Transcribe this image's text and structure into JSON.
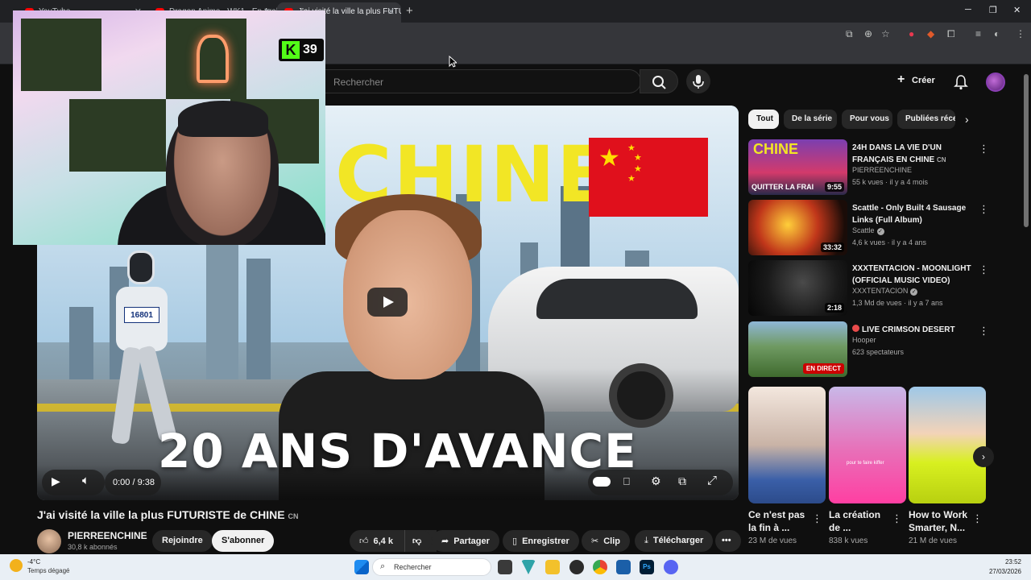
{
  "browser": {
    "tabs": [
      {
        "title": "YouTube"
      },
      {
        "title": "Dragon Anime - WK1 - En Arabe"
      },
      {
        "title": "J'ai visité la ville la plus FUTURISTE de CHINE"
      }
    ]
  },
  "header": {
    "search_placeholder": "Rechercher",
    "create_label": "Créer"
  },
  "player": {
    "thumb_title": "CHINE",
    "thumb_caption": "20 ANS D'AVANCE",
    "robot_bib": "16801",
    "time": "0:00 / 9:38"
  },
  "overlay": {
    "kick_count": "39"
  },
  "video": {
    "title": "J'ai visité la ville la plus FUTURISTE de CHINE",
    "title_suffix": "CN",
    "channel_name": "PIERREENCHINE",
    "subscribers": "30,8 k abonnés",
    "join_label": "Rejoindre",
    "subscribe_label": "S'abonner",
    "likes": "6,4 k",
    "share_label": "Partager",
    "save_label": "Enregistrer",
    "clip_label": "Clip",
    "download_label": "Télécharger"
  },
  "chips": [
    {
      "label": "Tout"
    },
    {
      "label": "De la série"
    },
    {
      "label": "Pour vous"
    },
    {
      "label": "Publiées récemment"
    }
  ],
  "recommendations": [
    {
      "title": "24H DANS LA VIE D'UN FRANÇAIS EN CHINE",
      "title_suffix": "CN",
      "channel": "PIERREENCHINE",
      "stats": "55 k vues · il y a 4 mois",
      "duration": "9:55",
      "thumb_text": "CHINE",
      "thumb_sub": "QUITTER LA FRAI"
    },
    {
      "title": "Scattle - Only Built 4 Sausage Links (Full Album)",
      "channel": "Scattle",
      "stats": "4,6 k vues · il y a 4 ans",
      "duration": "33:32"
    },
    {
      "title": "XXXTENTACION - MOONLIGHT (OFFICIAL MUSIC VIDEO)",
      "channel": "XXXTENTACION",
      "stats": "1,3 Md de vues · il y a 7 ans",
      "duration": "2:18"
    },
    {
      "title": "LIVE CRIMSON DESERT",
      "channel": "Hooper",
      "stats": "623 spectateurs",
      "live_badge": "EN DIRECT"
    }
  ],
  "shorts": [
    {
      "title": "Ce n'est pas la fin à ...",
      "views": "23 M de vues"
    },
    {
      "title": "La création de ...",
      "views": "838 k vues",
      "thumb_text": "pour te faire kiffer"
    },
    {
      "title": "How to Work Smarter, N...",
      "views": "21 M de vues"
    }
  ],
  "taskbar": {
    "temp": "-4°C",
    "weather": "Temps dégagé",
    "search_label": "Rechercher",
    "time": "23:52",
    "date": "27/03/2026"
  },
  "colors": {
    "background": "#0f0f0f",
    "youtube_red": "#ff0000",
    "kick_green": "#53fc18",
    "chip_active": "#f1f1f1",
    "live_red": "#cc0000"
  }
}
